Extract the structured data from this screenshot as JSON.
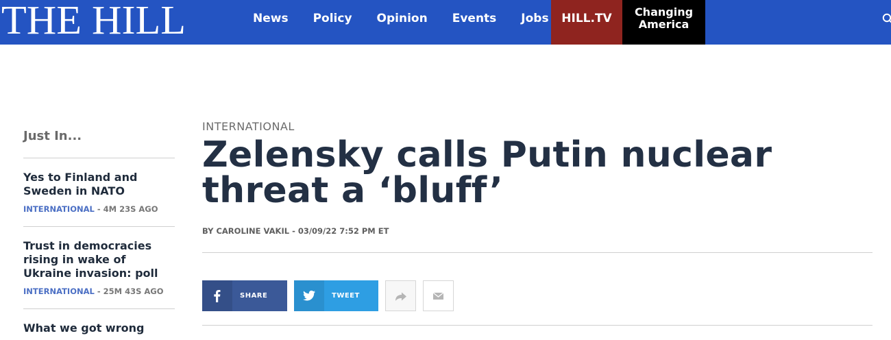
{
  "header": {
    "logo": "THE HILL",
    "nav": [
      "News",
      "Policy",
      "Opinion",
      "Events",
      "Jobs"
    ],
    "hilltv": "HILL.TV",
    "changing_line1": "Changing",
    "changing_line2": "America",
    "colors": {
      "bar": "#2454c2",
      "hilltv": "#8f241f",
      "changing": "#000000"
    }
  },
  "sidebar": {
    "title": "Just In...",
    "items": [
      {
        "headline": "Yes to Finland and Sweden in NATO",
        "category": "INTERNATIONAL",
        "time": "- 4M 23S AGO"
      },
      {
        "headline": "Trust in democracies rising in wake of Ukraine invasion: poll",
        "category": "INTERNATIONAL",
        "time": "- 25M 43S AGO"
      },
      {
        "headline": "What we got wrong",
        "category": "",
        "time": ""
      }
    ]
  },
  "article": {
    "category": "INTERNATIONAL",
    "headline": "Zelensky calls Putin nuclear threat a ‘bluff’",
    "byline": "BY CAROLINE VAKIL - 03/09/22 7:52 PM ET"
  },
  "share": {
    "facebook_label": "SHARE",
    "twitter_label": "TWEET",
    "icons": [
      "facebook-icon",
      "twitter-icon",
      "forward-icon",
      "mail-icon"
    ]
  }
}
